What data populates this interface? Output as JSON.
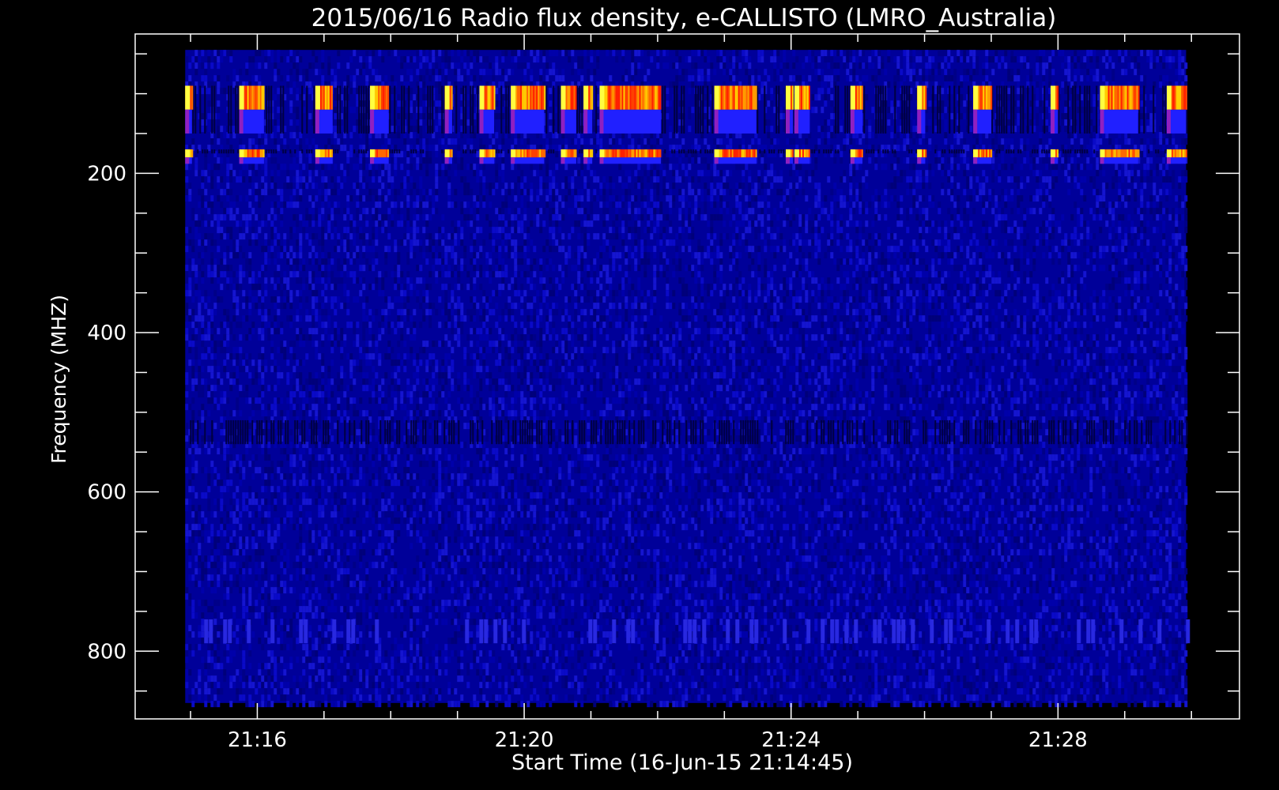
{
  "chart_data": {
    "type": "heatmap",
    "title": "2015/06/16  Radio flux density, e-CALLISTO (LMRO_Australia)",
    "xlabel": "Start Time (16-Jun-15 21:14:45)",
    "ylabel": "Frequency (MHZ)",
    "x_ticks": [
      "21:16",
      "21:20",
      "21:24",
      "21:28"
    ],
    "x_tick_values_min": [
      1.25,
      5.25,
      9.25,
      13.25
    ],
    "x_minor_step_min": 1,
    "y_ticks": [
      "200",
      "400",
      "600",
      "800"
    ],
    "y_tick_values": [
      200,
      400,
      600,
      800
    ],
    "y_minor_step": 50,
    "axis_x_range_min": [
      -0.58,
      15.97
    ],
    "axis_y_range": [
      25,
      885
    ],
    "data_x_range_min": [
      0.17,
      15.17
    ],
    "data_y_range": [
      45,
      865
    ],
    "y_reversed": true,
    "grid": false,
    "colormap": [
      "#000033",
      "#0000c0",
      "#2020ff",
      "#ff2000",
      "#ff8000",
      "#ffff40",
      "#ffffff"
    ],
    "background_level": "dark blue noise",
    "bursts": [
      {
        "t0": 0.17,
        "t1": 0.27
      },
      {
        "t0": 0.98,
        "t1": 1.35
      },
      {
        "t0": 2.12,
        "t1": 2.38
      },
      {
        "t0": 2.94,
        "t1": 3.22
      },
      {
        "t0": 4.06,
        "t1": 4.17
      },
      {
        "t0": 4.58,
        "t1": 4.8
      },
      {
        "t0": 5.05,
        "t1": 5.55
      },
      {
        "t0": 5.8,
        "t1": 6.03
      },
      {
        "t0": 6.14,
        "t1": 6.27
      },
      {
        "t0": 6.38,
        "t1": 7.3
      },
      {
        "t0": 8.1,
        "t1": 8.73
      },
      {
        "t0": 9.17,
        "t1": 9.28
      },
      {
        "t0": 9.3,
        "t1": 9.53
      },
      {
        "t0": 10.14,
        "t1": 10.32
      },
      {
        "t0": 11.14,
        "t1": 11.26
      },
      {
        "t0": 11.98,
        "t1": 12.25
      },
      {
        "t0": 13.14,
        "t1": 13.25
      },
      {
        "t0": 13.88,
        "t1": 14.45
      },
      {
        "t0": 14.88,
        "t1": 15.17
      }
    ],
    "burst_bands_mhz": [
      {
        "f0": 90,
        "f1": 120,
        "level": "hot"
      },
      {
        "f0": 120,
        "f1": 150,
        "level": "blue"
      },
      {
        "f0": 170,
        "f1": 180,
        "level": "hot"
      },
      {
        "f0": 180,
        "f1": 188,
        "level": "blue"
      }
    ],
    "rfi_dark_bands_mhz": [
      {
        "f0": 90,
        "f1": 150
      },
      {
        "f0": 170,
        "f1": 175
      },
      {
        "f0": 510,
        "f1": 540
      }
    ],
    "rfi_bright_bands_mhz": [
      {
        "f0": 760,
        "f1": 790
      }
    ]
  }
}
